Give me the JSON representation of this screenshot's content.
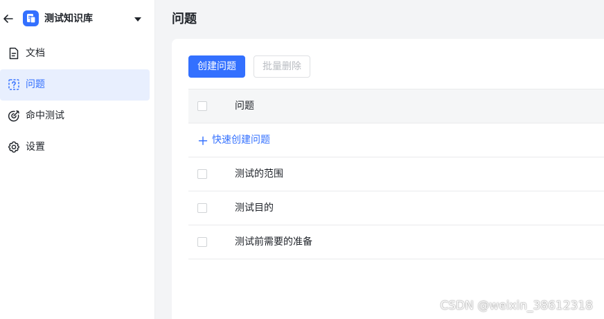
{
  "sidebar": {
    "kb_name": "测试知识库",
    "items": [
      {
        "label": "文档",
        "icon": "document-icon",
        "active": false
      },
      {
        "label": "问题",
        "icon": "question-icon",
        "active": true
      },
      {
        "label": "命中测试",
        "icon": "target-icon",
        "active": false
      },
      {
        "label": "设置",
        "icon": "gear-icon",
        "active": false
      }
    ]
  },
  "main": {
    "title": "问题",
    "toolbar": {
      "create_label": "创建问题",
      "batch_delete_label": "批量删除"
    },
    "table": {
      "header": "问题",
      "quick_add_label": "快速创建问题",
      "rows": [
        {
          "question": "测试的范围"
        },
        {
          "question": "测试目的"
        },
        {
          "question": "测试前需要的准备"
        }
      ]
    }
  },
  "watermark": "CSDN @weixin_38612318",
  "colors": {
    "accent": "#3370ff",
    "active_bg": "#e8effe",
    "page_bg": "#f3f4f6"
  }
}
